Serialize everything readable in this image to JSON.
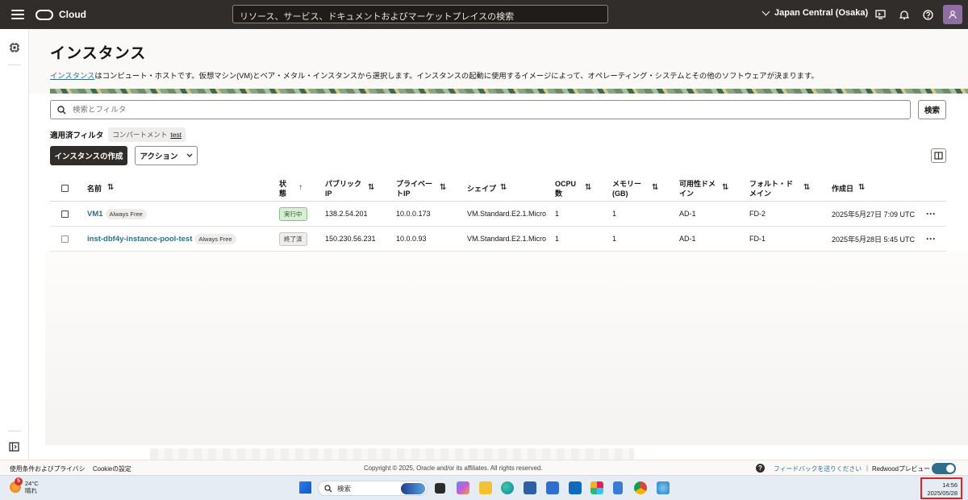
{
  "topbar": {
    "brand": "Cloud",
    "search_placeholder": "リソース、サービス、ドキュメントおよびマーケットプレイスの検索",
    "region": "Japan Central (Osaka)"
  },
  "page": {
    "title": "インスタンス",
    "desc_link": "インスタンス",
    "desc_rest": "はコンピュート・ホストです。仮想マシン(VM)とベア・メタル・インスタンスから選択します。インスタンスの起動に使用するイメージによって、オペレーティング・システムとその他のソフトウェアが決まります。"
  },
  "search": {
    "placeholder": "検索とフィルタ",
    "button": "検索"
  },
  "filters": {
    "label": "適用済フィルタ",
    "chip_key": "コンパートメント",
    "chip_value": "test"
  },
  "toolbar": {
    "create": "インスタンスの作成",
    "actions": "アクション"
  },
  "table": {
    "headers": {
      "name": "名前",
      "state_1": "状",
      "state_2": "態",
      "public_ip_1": "パブリック",
      "public_ip_2": "IP",
      "private_ip_1": "プライベー",
      "private_ip_2": "トIP",
      "shape": "シェイプ",
      "ocpu_1": "OCPU",
      "ocpu_2": "数",
      "memory_1": "メモリー",
      "memory_2": "(GB)",
      "ad_1": "可用性ドメ",
      "ad_2": "イン",
      "fd_1": "フォルト・ド",
      "fd_2": "メイン",
      "created": "作成日"
    },
    "rows": [
      {
        "name": "VM1",
        "tag": "Always Free",
        "state": "実行中",
        "public_ip": "138.2.54.201",
        "private_ip": "10.0.0.173",
        "shape": "VM.Standard.E2.1.Micro",
        "ocpu": "1",
        "memory": "1",
        "ad": "AD-1",
        "fd": "FD-2",
        "created": "2025年5月27日 7:09 UTC"
      },
      {
        "name": "inst-dbf4y-instance-pool-test",
        "tag": "Always Free",
        "state": "終了済",
        "public_ip": "150.230.56.231",
        "private_ip": "10.0.0.93",
        "shape": "VM.Standard.E2.1.Micro",
        "ocpu": "1",
        "memory": "1",
        "ad": "AD-1",
        "fd": "FD-1",
        "created": "2025年5月28日 5:45 UTC"
      }
    ]
  },
  "footer": {
    "terms": "使用条件およびプライバシ",
    "cookie": "Cookieの設定",
    "copyright": "Copyright © 2025, Oracle and/or its affiliates. All rights reserved.",
    "feedback": "フィードバックを送りください",
    "separator": "|",
    "redwood": "Redwoodプレビュー"
  },
  "taskbar": {
    "weather_badge": "5",
    "temp": "24°C",
    "condition": "晴れ",
    "search": "検索",
    "time": "14:56",
    "date": "2025/05/28"
  },
  "colors": {
    "topbar_bg": "#312d2a",
    "link": "#2e6e8a",
    "running_badge": "#d8efd6",
    "highlight_box": "#e02424"
  }
}
